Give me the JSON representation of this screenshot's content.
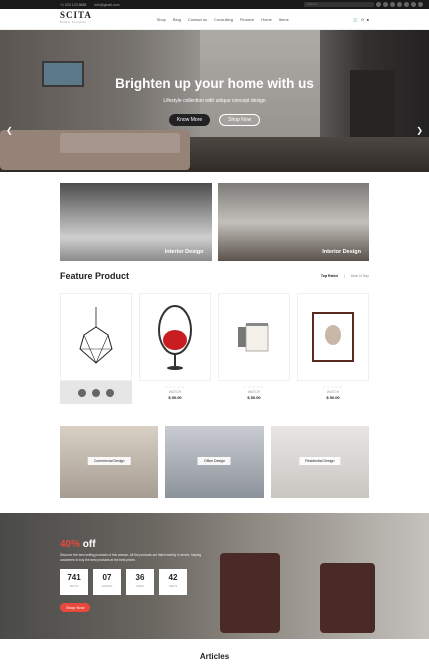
{
  "topbar": {
    "phone": "+1 023 123 8888",
    "email": "info@gmail.com",
    "search_placeholder": "Search..."
  },
  "header": {
    "logo": "SCITA",
    "logo_sub": "Simple Furniture",
    "nav": [
      "Shop",
      "Blog",
      "Contact us",
      "Consulting",
      "Finance",
      "Home",
      "Items"
    ],
    "cart_count": "0"
  },
  "hero": {
    "title": "Brighten up your home with us",
    "subtitle": "Lifestyle collection with unique concept design",
    "btn_primary": "Know More",
    "btn_secondary": "Shop Now"
  },
  "banners": [
    {
      "caption": "Interior Design"
    },
    {
      "caption": "Interior Design"
    }
  ],
  "feature": {
    "title": "Feature Product",
    "tabs": [
      "Top Rated",
      "Deal of Day"
    ]
  },
  "products": [
    {
      "name": "",
      "price": ""
    },
    {
      "name": "WATCH",
      "price": "$ 50.00"
    },
    {
      "name": "WATCH",
      "price": "$ 50.00"
    },
    {
      "name": "WATCH",
      "price": "$ 50.00"
    }
  ],
  "categories": [
    {
      "label": "Commercial Design"
    },
    {
      "label": "Office Design"
    },
    {
      "label": "Residential Design"
    }
  ],
  "promo": {
    "discount": "40%",
    "off": "off",
    "text": "Discover the best selling products of this season. All the products are listed weekly in stores, helping customers to buy the best products at the best prices.",
    "counters": [
      {
        "value": "741",
        "unit": "DAYS"
      },
      {
        "value": "07",
        "unit": "HOURS"
      },
      {
        "value": "36",
        "unit": "MINS"
      },
      {
        "value": "42",
        "unit": "SECS"
      }
    ],
    "button": "Shop Now"
  },
  "articles_title": "Articles",
  "colors": {
    "accent": "#e9483d",
    "dark": "#222222"
  }
}
